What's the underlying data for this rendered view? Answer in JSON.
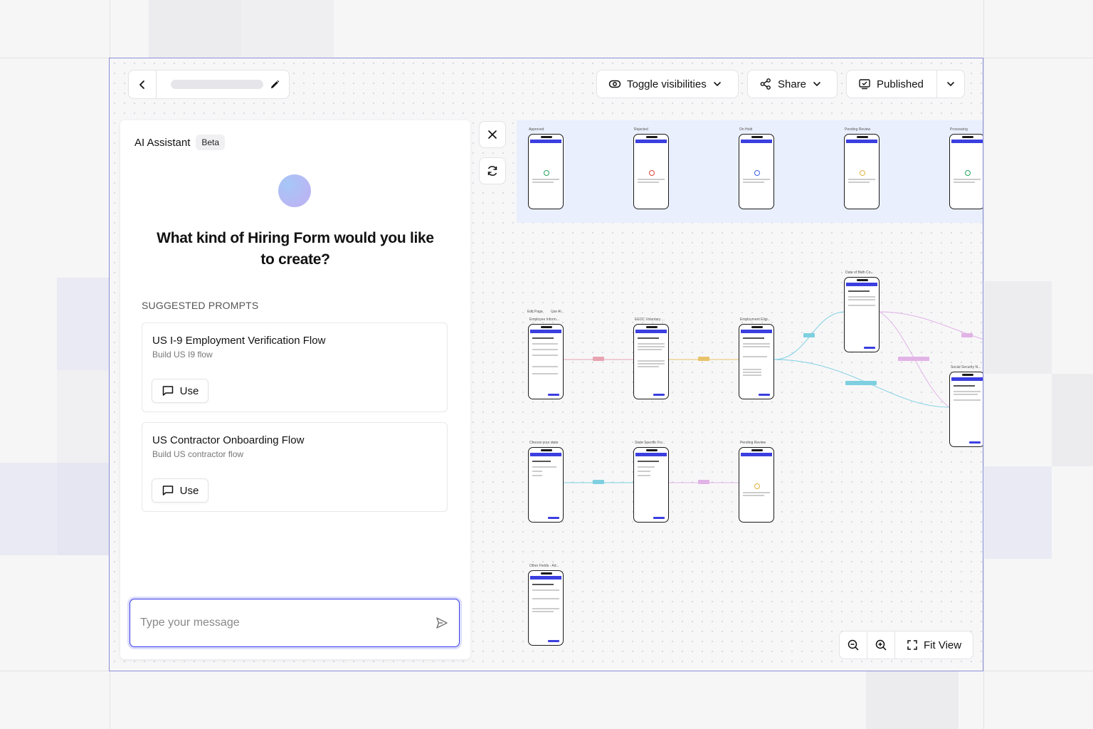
{
  "header": {
    "toggle_label": "Toggle visibilities",
    "share_label": "Share",
    "published_label": "Published"
  },
  "ai": {
    "title": "AI Assistant",
    "badge": "Beta",
    "question": "What kind of Hiring Form would you like to create?",
    "suggested_heading": "SUGGESTED PROMPTS",
    "prompts": [
      {
        "title": "US I-9 Employment Verification Flow",
        "subtitle": "Build US I9 flow",
        "action": "Use"
      },
      {
        "title": "US Contractor Onboarding Flow",
        "subtitle": "Build US contractor flow",
        "action": "Use"
      }
    ],
    "input_placeholder": "Type your message"
  },
  "canvas": {
    "status_nodes": [
      "Approved",
      "Rejected",
      "On Hold",
      "Pending Review",
      "Processing"
    ],
    "status_colors": [
      "#22a55a",
      "#e0443c",
      "#3b5fe0",
      "#e0b23c",
      "#22a55a"
    ],
    "toolbar": {
      "edit": "Edit Page",
      "ai": "Use AI"
    },
    "nodes": [
      "Employee Inform...",
      "EEOC Voluntary ...",
      "Employment Eligi...",
      "Date of Birth Co...",
      "Social Security N...",
      "Choose your state",
      "State Specific Fo...",
      "Pending Review",
      "Other Fields - Ad..."
    ],
    "accent": "#3b3fe0"
  },
  "zoom": {
    "fit_label": "Fit View"
  }
}
